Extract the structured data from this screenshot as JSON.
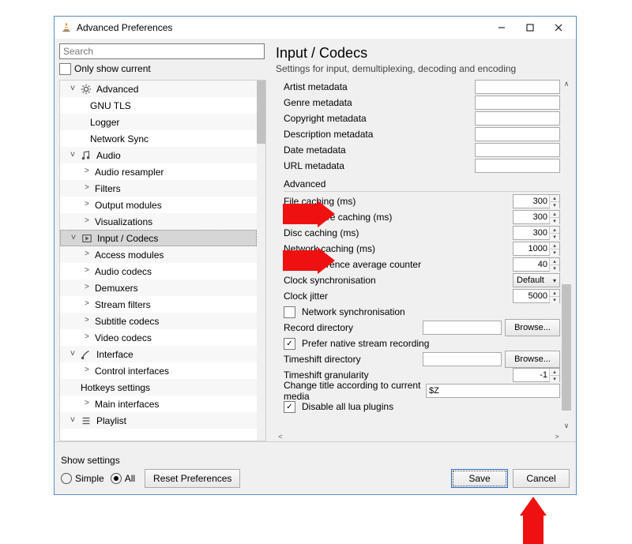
{
  "window": {
    "title": "Advanced Preferences"
  },
  "search": {
    "placeholder": "Search"
  },
  "only_show_current": {
    "label": "Only show current",
    "checked": false
  },
  "tree": [
    {
      "type": "cat",
      "label": "Advanced",
      "icon": "gear",
      "open": true
    },
    {
      "type": "leaf",
      "label": "GNU TLS",
      "indent": "indent1"
    },
    {
      "type": "leaf",
      "label": "Logger",
      "indent": "indent1"
    },
    {
      "type": "leaf",
      "label": "Network Sync",
      "indent": "indent1"
    },
    {
      "type": "cat",
      "label": "Audio",
      "icon": "note",
      "open": true
    },
    {
      "type": "sub",
      "label": "Audio resampler",
      "indent": "indent2"
    },
    {
      "type": "sub",
      "label": "Filters",
      "indent": "indent2"
    },
    {
      "type": "sub",
      "label": "Output modules",
      "indent": "indent2"
    },
    {
      "type": "sub",
      "label": "Visualizations",
      "indent": "indent2"
    },
    {
      "type": "cat",
      "label": "Input / Codecs",
      "icon": "codec",
      "open": true,
      "selected": true
    },
    {
      "type": "sub",
      "label": "Access modules",
      "indent": "indent2"
    },
    {
      "type": "sub",
      "label": "Audio codecs",
      "indent": "indent2"
    },
    {
      "type": "sub",
      "label": "Demuxers",
      "indent": "indent2"
    },
    {
      "type": "sub",
      "label": "Stream filters",
      "indent": "indent2"
    },
    {
      "type": "sub",
      "label": "Subtitle codecs",
      "indent": "indent2"
    },
    {
      "type": "sub",
      "label": "Video codecs",
      "indent": "indent2"
    },
    {
      "type": "cat",
      "label": "Interface",
      "icon": "brush",
      "open": true
    },
    {
      "type": "sub",
      "label": "Control interfaces",
      "indent": "indent2"
    },
    {
      "type": "leaf",
      "label": "Hotkeys settings",
      "indent": "indent1b"
    },
    {
      "type": "sub",
      "label": "Main interfaces",
      "indent": "indent2"
    },
    {
      "type": "cat",
      "label": "Playlist",
      "icon": "list",
      "open": true
    }
  ],
  "page": {
    "title": "Input / Codecs",
    "subtitle": "Settings for input, demultiplexing, decoding and encoding"
  },
  "metadata_rows": [
    {
      "label": "Artist metadata"
    },
    {
      "label": "Genre metadata"
    },
    {
      "label": "Copyright metadata"
    },
    {
      "label": "Description metadata"
    },
    {
      "label": "Date metadata"
    },
    {
      "label": "URL metadata"
    }
  ],
  "advanced_group_label": "Advanced",
  "adv": {
    "file_caching": {
      "label": "File caching (ms)",
      "value": "300"
    },
    "live_caching": {
      "label": "Live capture caching (ms)",
      "value": "300"
    },
    "disc_caching": {
      "label": "Disc caching (ms)",
      "value": "300"
    },
    "network_caching": {
      "label": "Network caching (ms)",
      "value": "1000"
    },
    "clock_ref": {
      "label": "Clock reference average counter",
      "value": "40"
    },
    "clock_sync": {
      "label": "Clock synchronisation",
      "value": "Default"
    },
    "clock_jitter": {
      "label": "Clock jitter",
      "value": "5000"
    },
    "network_sync": {
      "label": "Network synchronisation",
      "checked": false
    },
    "record_dir": {
      "label": "Record directory",
      "value": "",
      "browse": "Browse..."
    },
    "prefer_native": {
      "label": "Prefer native stream recording",
      "checked": true
    },
    "timeshift_dir": {
      "label": "Timeshift directory",
      "value": "",
      "browse": "Browse..."
    },
    "timeshift_gran": {
      "label": "Timeshift granularity",
      "value": "-1"
    },
    "change_title": {
      "label": "Change title according to current media",
      "value": "$Z"
    },
    "disable_lua": {
      "label": "Disable all lua plugins",
      "checked": true
    }
  },
  "footer": {
    "show_settings": "Show settings",
    "simple": "Simple",
    "all": "All",
    "reset": "Reset Preferences",
    "save": "Save",
    "cancel": "Cancel"
  }
}
